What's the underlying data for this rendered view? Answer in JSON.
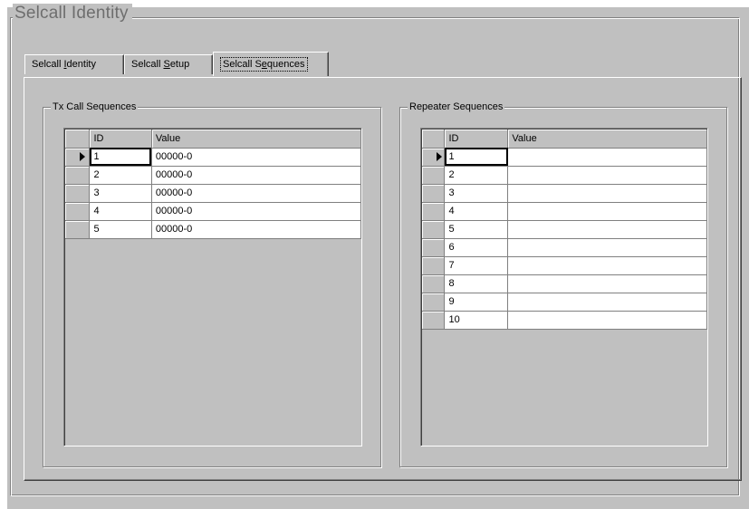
{
  "window": {
    "group_title": "Selcall Identity"
  },
  "tabs": [
    {
      "pre": "Selcall ",
      "u": "I",
      "post": "dentity"
    },
    {
      "pre": "Selcall ",
      "u": "S",
      "post": "etup"
    },
    {
      "pre": "Selcall S",
      "u": "e",
      "post": "quences"
    }
  ],
  "tx_group": {
    "title": "Tx Call Sequences",
    "columns": [
      "ID",
      "Value"
    ],
    "rows": [
      {
        "id": "1",
        "value": "00000-0"
      },
      {
        "id": "2",
        "value": "00000-0"
      },
      {
        "id": "3",
        "value": "00000-0"
      },
      {
        "id": "4",
        "value": "00000-0"
      },
      {
        "id": "5",
        "value": "00000-0"
      }
    ]
  },
  "rep_group": {
    "title": "Repeater Sequences",
    "columns": [
      "ID",
      "Value"
    ],
    "rows": [
      {
        "id": "1",
        "value": ""
      },
      {
        "id": "2",
        "value": ""
      },
      {
        "id": "3",
        "value": ""
      },
      {
        "id": "4",
        "value": ""
      },
      {
        "id": "5",
        "value": ""
      },
      {
        "id": "6",
        "value": ""
      },
      {
        "id": "7",
        "value": ""
      },
      {
        "id": "8",
        "value": ""
      },
      {
        "id": "9",
        "value": ""
      },
      {
        "id": "10",
        "value": ""
      }
    ]
  }
}
